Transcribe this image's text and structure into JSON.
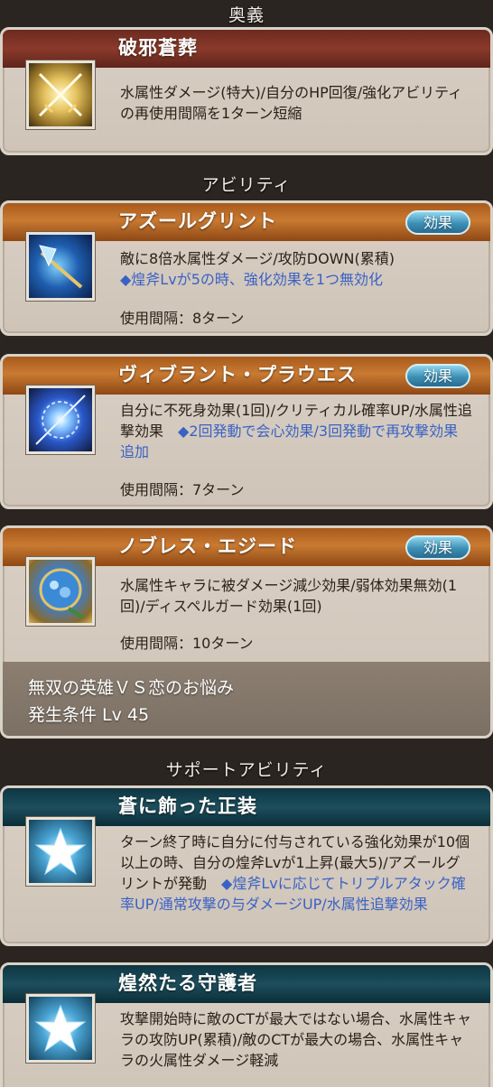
{
  "sections": {
    "ougi": "奥義",
    "ability": "アビリティ",
    "support": "サポートアビリティ"
  },
  "ougi": {
    "name": "破邪蒼葬",
    "desc": "水属性ダメージ(特大)/自分のHP回復/強化アビリティの再使用間隔を1ターン短縮",
    "icon": "crossed-swords-icon"
  },
  "abilities": [
    {
      "name": "アズールグリント",
      "badge": "効果",
      "desc": "敵に8倍水属性ダメージ/攻防DOWN(累積)",
      "desc_blue": "◆煌斧Lvが5の時、強化効果を1つ無効化",
      "cooldown": "使用間隔：8ターン",
      "icon": "axe-icon"
    },
    {
      "name": "ヴィブラント・プラウエス",
      "badge": "効果",
      "desc": "自分に不死身効果(1回)/クリティカル確率UP/水属性追撃効果　",
      "desc_blue": "◆2回発動で会心効果/3回発動で再攻撃効果追加",
      "cooldown": "使用間隔：7ターン",
      "icon": "blue-orb-icon"
    },
    {
      "name": "ノブレス・エジード",
      "badge": "効果",
      "desc": "水属性キャラに被ダメージ減少効果/弱体効果無効(1回)/ディスペルガード効果(1回)",
      "desc_blue": "",
      "cooldown": "使用間隔：10ターン",
      "icon": "blue-shield-icon",
      "unlock_title": "無双の英雄ＶＳ恋のお悩み",
      "unlock_level": "発生条件 Lv 45"
    }
  ],
  "supports": [
    {
      "name": "蒼に飾った正装",
      "desc": "ターン終了時に自分に付与されている強化効果が10個以上の時、自分の煌斧Lvが1上昇(最大5)/アズールグリントが発動　",
      "desc_blue": "◆煌斧Lvに応じてトリプルアタック確率UP/通常攻撃の与ダメージUP/水属性追撃効果",
      "icon": "star-icon"
    },
    {
      "name": "煌然たる守護者",
      "desc": "攻撃開始時に敵のCTが最大ではない場合、水属性キャラの攻防UP(累積)/敵のCTが最大の場合、水属性キャラの火属性ダメージ軽減",
      "desc_blue": "",
      "icon": "star-icon"
    }
  ]
}
